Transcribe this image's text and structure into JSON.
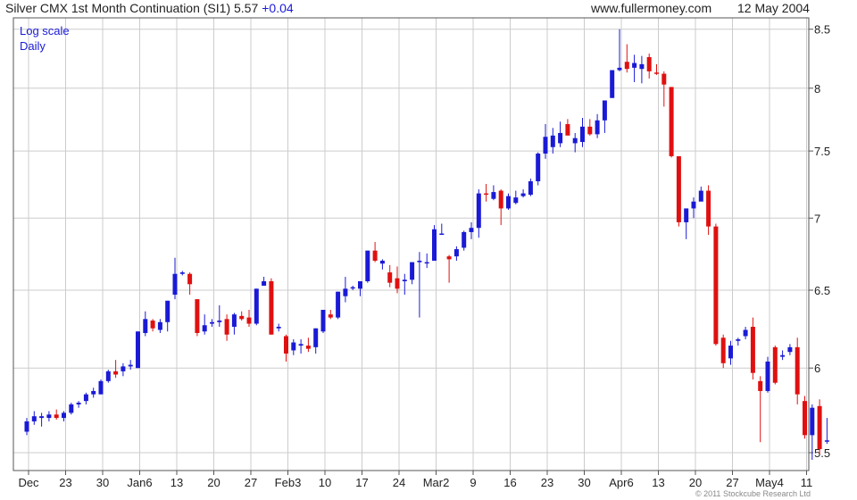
{
  "header": {
    "title": "Silver CMX 1st Month Continuation (SI1) 5.57",
    "change": "+0.04",
    "site": "www.fullermoney.com",
    "date": "12 May 2004"
  },
  "notes": {
    "scale": "Log scale",
    "period": "Daily"
  },
  "copyright": "© 2011 Stockcube Research Ltd",
  "colors": {
    "up": "#1a1ad6",
    "down": "#e01010",
    "grid": "#cccccc",
    "frame": "#555555"
  },
  "chart_data": {
    "type": "candlestick",
    "title": "Silver CMX 1st Month Continuation (SI1)",
    "y_scale": "log",
    "ylim": [
      5.4,
      8.6
    ],
    "y_ticks": [
      5.5,
      6,
      6.5,
      7,
      7.5,
      8,
      8.5
    ],
    "grid": true,
    "x_ticks": [
      {
        "index": 0,
        "label": "Dec"
      },
      {
        "index": 5,
        "label": "23"
      },
      {
        "index": 10,
        "label": "30"
      },
      {
        "index": 15,
        "label": "Jan6"
      },
      {
        "index": 20,
        "label": "13"
      },
      {
        "index": 25,
        "label": "20"
      },
      {
        "index": 30,
        "label": "27"
      },
      {
        "index": 35,
        "label": "Feb3"
      },
      {
        "index": 40,
        "label": "10"
      },
      {
        "index": 45,
        "label": "17"
      },
      {
        "index": 50,
        "label": "24"
      },
      {
        "index": 55,
        "label": "Mar2"
      },
      {
        "index": 60,
        "label": "9"
      },
      {
        "index": 65,
        "label": "16"
      },
      {
        "index": 70,
        "label": "23"
      },
      {
        "index": 75,
        "label": "30"
      },
      {
        "index": 80,
        "label": "Apr6"
      },
      {
        "index": 85,
        "label": "13"
      },
      {
        "index": 90,
        "label": "20"
      },
      {
        "index": 95,
        "label": "27"
      },
      {
        "index": 100,
        "label": "May4"
      },
      {
        "index": 105,
        "label": "11"
      }
    ],
    "candles": [
      [
        5.62,
        5.7,
        5.6,
        5.68
      ],
      [
        5.68,
        5.74,
        5.66,
        5.71
      ],
      [
        5.7,
        5.73,
        5.65,
        5.71
      ],
      [
        5.7,
        5.74,
        5.68,
        5.72
      ],
      [
        5.72,
        5.75,
        5.69,
        5.7
      ],
      [
        5.7,
        5.74,
        5.68,
        5.73
      ],
      [
        5.73,
        5.79,
        5.72,
        5.78
      ],
      [
        5.78,
        5.8,
        5.76,
        5.79
      ],
      [
        5.8,
        5.85,
        5.78,
        5.84
      ],
      [
        5.84,
        5.88,
        5.82,
        5.86
      ],
      [
        5.84,
        5.93,
        5.84,
        5.92
      ],
      [
        5.92,
        5.99,
        5.91,
        5.98
      ],
      [
        5.98,
        6.05,
        5.94,
        5.96
      ],
      [
        5.98,
        6.03,
        5.95,
        6.01
      ],
      [
        6.01,
        6.05,
        5.99,
        6.02
      ],
      [
        6.0,
        6.23,
        6.0,
        6.23
      ],
      [
        6.22,
        6.36,
        6.2,
        6.31
      ],
      [
        6.3,
        6.31,
        6.23,
        6.25
      ],
      [
        6.24,
        6.31,
        6.22,
        6.29
      ],
      [
        6.29,
        6.43,
        6.23,
        6.43
      ],
      [
        6.47,
        6.72,
        6.44,
        6.61
      ],
      [
        6.61,
        6.63,
        6.6,
        6.62
      ],
      [
        6.61,
        6.62,
        6.47,
        6.54
      ],
      [
        6.44,
        6.44,
        6.2,
        6.22
      ],
      [
        6.23,
        6.34,
        6.21,
        6.27
      ],
      [
        6.28,
        6.31,
        6.26,
        6.29
      ],
      [
        6.29,
        6.4,
        6.26,
        6.3
      ],
      [
        6.31,
        6.34,
        6.17,
        6.21
      ],
      [
        6.26,
        6.35,
        6.21,
        6.34
      ],
      [
        6.33,
        6.36,
        6.3,
        6.31
      ],
      [
        6.32,
        6.37,
        6.26,
        6.28
      ],
      [
        6.28,
        6.51,
        6.27,
        6.51
      ],
      [
        6.53,
        6.59,
        6.54,
        6.56
      ],
      [
        6.56,
        6.58,
        6.21,
        6.21
      ],
      [
        6.25,
        6.28,
        6.23,
        6.26
      ],
      [
        6.2,
        6.21,
        6.04,
        6.09
      ],
      [
        6.11,
        6.18,
        6.08,
        6.16
      ],
      [
        6.14,
        6.18,
        6.09,
        6.15
      ],
      [
        6.14,
        6.19,
        6.1,
        6.12
      ],
      [
        6.13,
        6.25,
        6.09,
        6.25
      ],
      [
        6.23,
        6.37,
        6.22,
        6.37
      ],
      [
        6.34,
        6.37,
        6.31,
        6.32
      ],
      [
        6.32,
        6.49,
        6.31,
        6.49
      ],
      [
        6.46,
        6.59,
        6.42,
        6.51
      ],
      [
        6.52,
        6.53,
        6.5,
        6.52
      ],
      [
        6.51,
        6.56,
        6.46,
        6.56
      ],
      [
        6.56,
        6.77,
        6.55,
        6.77
      ],
      [
        6.77,
        6.83,
        6.69,
        6.7
      ],
      [
        6.68,
        6.71,
        6.64,
        6.7
      ],
      [
        6.62,
        6.67,
        6.52,
        6.55
      ],
      [
        6.58,
        6.66,
        6.48,
        6.51
      ],
      [
        6.56,
        6.61,
        6.47,
        6.57
      ],
      [
        6.57,
        6.69,
        6.54,
        6.69
      ],
      [
        6.69,
        6.76,
        6.32,
        6.7
      ],
      [
        6.69,
        6.75,
        6.65,
        6.69
      ],
      [
        6.7,
        6.95,
        6.7,
        6.92
      ],
      [
        6.89,
        6.96,
        6.89,
        6.89
      ],
      [
        6.73,
        6.74,
        6.55,
        6.71
      ],
      [
        6.73,
        6.8,
        6.7,
        6.78
      ],
      [
        6.79,
        6.91,
        6.77,
        6.9
      ],
      [
        6.9,
        6.97,
        6.85,
        6.93
      ],
      [
        6.93,
        7.21,
        6.86,
        7.18
      ],
      [
        7.18,
        7.25,
        7.12,
        7.17
      ],
      [
        7.14,
        7.24,
        7.13,
        7.19
      ],
      [
        7.2,
        7.21,
        6.95,
        7.07
      ],
      [
        7.07,
        7.18,
        7.06,
        7.16
      ],
      [
        7.11,
        7.2,
        7.1,
        7.15
      ],
      [
        7.16,
        7.21,
        7.15,
        7.18
      ],
      [
        7.17,
        7.29,
        7.16,
        7.27
      ],
      [
        7.27,
        7.49,
        7.24,
        7.48
      ],
      [
        7.48,
        7.71,
        7.44,
        7.61
      ],
      [
        7.53,
        7.68,
        7.48,
        7.62
      ],
      [
        7.56,
        7.73,
        7.53,
        7.64
      ],
      [
        7.71,
        7.75,
        7.71,
        7.62
      ],
      [
        7.56,
        7.64,
        7.49,
        7.6
      ],
      [
        7.57,
        7.76,
        7.53,
        7.69
      ],
      [
        7.69,
        7.75,
        7.62,
        7.63
      ],
      [
        7.63,
        7.79,
        7.6,
        7.74
      ],
      [
        7.74,
        7.9,
        7.64,
        7.9
      ],
      [
        7.92,
        8.15,
        7.92,
        8.15
      ],
      [
        8.15,
        8.5,
        8.14,
        8.17
      ],
      [
        8.22,
        8.37,
        8.13,
        8.16
      ],
      [
        8.17,
        8.28,
        8.05,
        8.21
      ],
      [
        8.16,
        8.27,
        8.04,
        8.2
      ],
      [
        8.26,
        8.29,
        8.08,
        8.14
      ],
      [
        8.13,
        8.2,
        8.11,
        8.12
      ],
      [
        8.12,
        8.14,
        7.85,
        8.03
      ],
      [
        8.01,
        8.01,
        7.45,
        7.46
      ],
      [
        7.46,
        7.46,
        6.94,
        6.97
      ],
      [
        6.97,
        7.04,
        6.85,
        7.07
      ],
      [
        7.07,
        7.15,
        7.0,
        7.12
      ],
      [
        7.12,
        7.23,
        7.19,
        7.2
      ],
      [
        7.2,
        7.24,
        6.88,
        6.94
      ],
      [
        6.94,
        6.96,
        6.14,
        6.15
      ],
      [
        6.19,
        6.21,
        6.0,
        6.03
      ],
      [
        6.06,
        6.17,
        6.02,
        6.14
      ],
      [
        6.17,
        6.19,
        6.14,
        6.18
      ],
      [
        6.2,
        6.26,
        6.18,
        6.24
      ],
      [
        6.26,
        6.32,
        5.93,
        5.97
      ],
      [
        5.92,
        5.95,
        5.56,
        5.86
      ],
      [
        5.86,
        6.07,
        5.85,
        6.04
      ],
      [
        6.13,
        6.14,
        5.9,
        5.91
      ],
      [
        6.07,
        6.11,
        6.05,
        6.08
      ],
      [
        6.1,
        6.15,
        6.08,
        6.13
      ],
      [
        6.13,
        6.19,
        5.78,
        5.84
      ],
      [
        5.8,
        5.83,
        5.58,
        5.6
      ],
      [
        5.6,
        5.78,
        5.46,
        5.76
      ],
      [
        5.77,
        5.81,
        5.49,
        5.52
      ],
      [
        5.57,
        5.7,
        5.55,
        5.57
      ]
    ]
  }
}
